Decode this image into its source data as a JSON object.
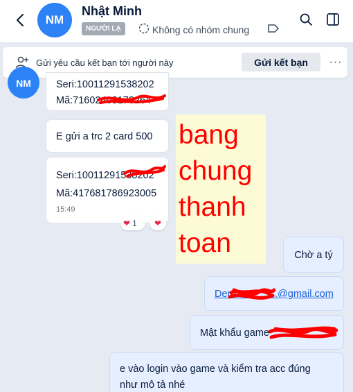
{
  "header": {
    "avatar_initials": "NM",
    "name": "Nhật Minh",
    "badge": "NGƯỜI LẠ",
    "group_status": "Không có nhóm chung",
    "icons": [
      "back-arrow-icon",
      "group-icon",
      "tag-icon",
      "search-icon",
      "sidebar-panel-icon"
    ]
  },
  "friend_request": {
    "text": "Gửi yêu cầu kết bạn tới người này",
    "button": "Gửi kết bạn",
    "more": "···"
  },
  "messages": {
    "avatar_initials": "NM",
    "m1": {
      "line1": "Seri:10011291538202",
      "line2": "Mã:71602408173264"
    },
    "m2": {
      "text": "E gửi a trc 2 card 500"
    },
    "m3": {
      "line1": "Seri:10011291538202",
      "line2": "Mã:417681786923005",
      "time": "15:49"
    },
    "reactions": [
      {
        "emoji": "❤",
        "count": "1"
      },
      {
        "emoji": "❤"
      }
    ],
    "note": {
      "lines": [
        "bang",
        "chung",
        "thanh",
        "toan"
      ]
    },
    "m4": {
      "text": "Chờ a tý"
    },
    "m5": {
      "email": "Dem...............@gmail.com"
    },
    "m6": {
      "text": "Mật khẩu game"
    },
    "m7": {
      "line1": "e vào login vào game và kiểm tra acc đúng",
      "line2": "như mô tả nhé"
    }
  },
  "colors": {
    "accent": "#2d82f5",
    "scribble": "#ff0000",
    "my_bubble": "#e5efff",
    "background": "#e6ebf3"
  }
}
